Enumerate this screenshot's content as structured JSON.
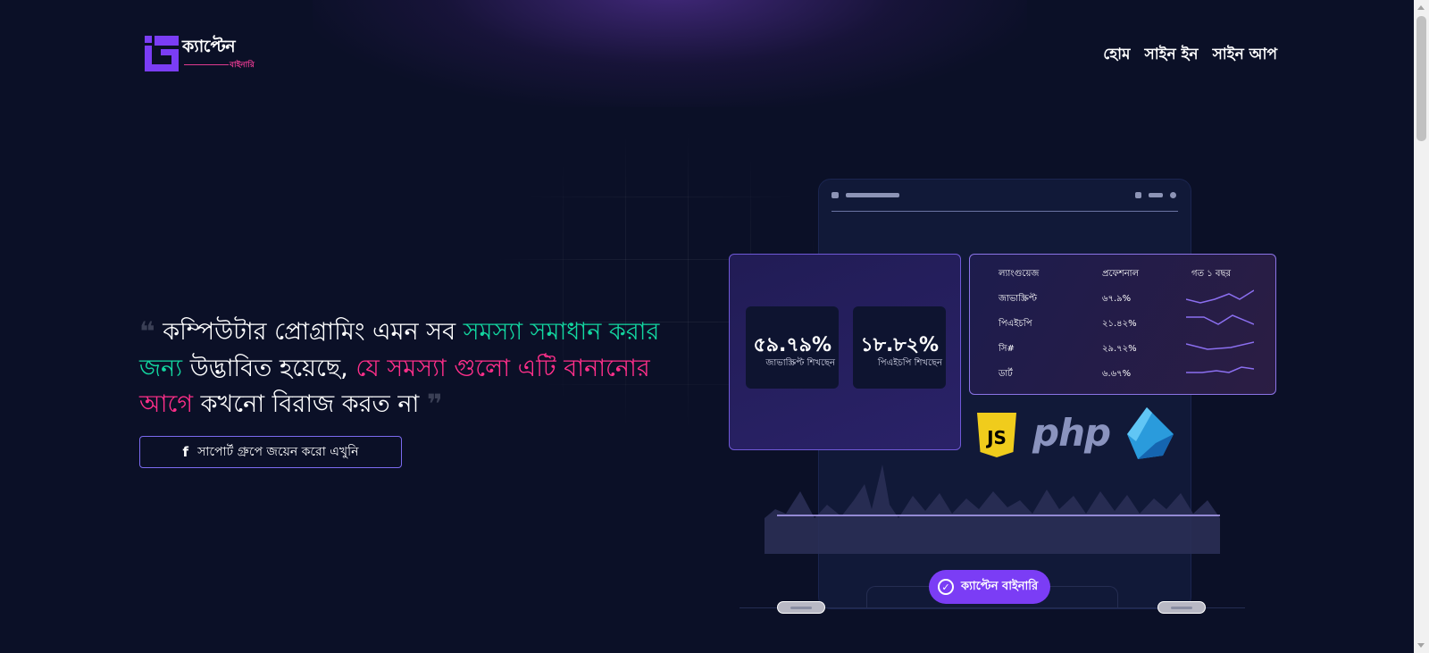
{
  "brand": {
    "name": "ক্যাপ্টেন",
    "sub": "বাইনারি"
  },
  "nav": {
    "items": [
      "হোম",
      "সাইন ইন",
      "সাইন আপ"
    ]
  },
  "hero": {
    "quote_open": "❝",
    "text_1": "কম্পিউটার প্রোগ্রামিং এমন সব ",
    "text_2_green": "সমস্যা সমাধান করার জন্য",
    "text_3": " উদ্ভাবিত হয়েছে, ",
    "text_4_pink": "যে সমস্যা গুলো এটি বানানোর আগে",
    "text_5": " কখনো বিরাজ করত না ",
    "quote_close": "❞",
    "support_button": "সাপোর্ট গ্রুপে জয়েন করো এখুনি",
    "support_icon": "facebook-icon"
  },
  "stats": [
    {
      "value": "৫৯.৭৯%",
      "label": "জাভাস্ক্রিপ্ট শিখছেন"
    },
    {
      "value": "১৮.৮২%",
      "label": "পিএইচপি শিখছেন"
    }
  ],
  "languages_table": {
    "headers": [
      "ল্যাংগুয়েজ",
      "প্রফেশনাল",
      "গত ১ বছর"
    ],
    "rows": [
      {
        "name": "জাভাস্ক্রিপ্ট",
        "value": "৬৭.৯%"
      },
      {
        "name": "পিএইচপি",
        "value": "২১.৪২%"
      },
      {
        "name": "সি#",
        "value": "২৯.৭২%"
      },
      {
        "name": "ডার্ট",
        "value": "৬.৬৭%"
      }
    ]
  },
  "tech_logos": {
    "js": "JS",
    "php": "php",
    "dart": "dart-logo"
  },
  "badge": {
    "label": "ক্যাপ্টেন বাইনারি",
    "icon": "check-circle-icon"
  },
  "colors": {
    "background": "#0b1027",
    "green": "#13d6a0",
    "pink": "#ff2f8a",
    "accent": "#7b3df5"
  }
}
